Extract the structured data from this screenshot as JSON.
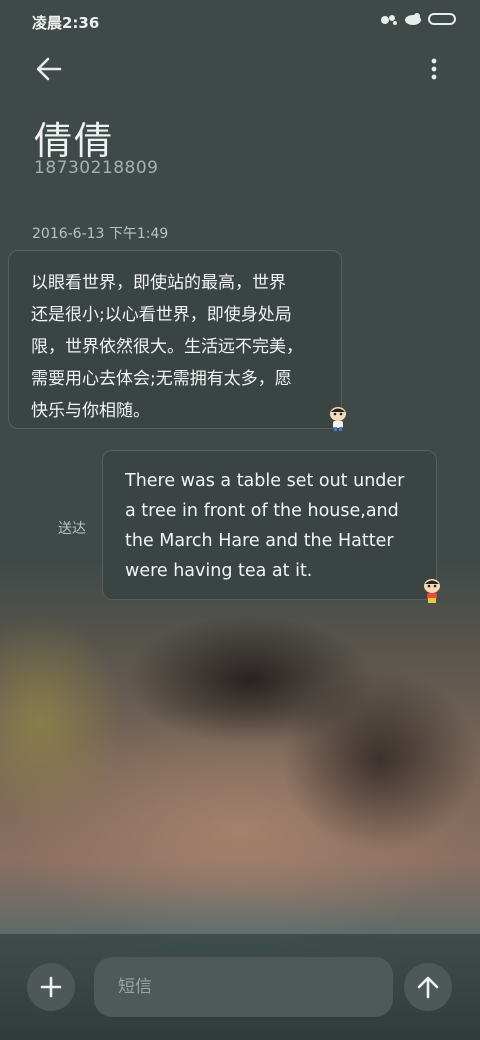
{
  "status_bar": {
    "time": "凌晨2:36"
  },
  "header": {
    "contact_name": "倩倩",
    "contact_number": "18730218809"
  },
  "conversation": {
    "timestamp": "2016-6-13 下午1:49",
    "messages": [
      {
        "direction": "incoming",
        "lines": [
          "以眼看世界，即使站的最高，世界",
          "还是很小;以心看世界，即使身处局",
          "限，世界依然很大。生活远不完美，",
          "需要用心去体会;无需拥有太多，愿",
          "快乐与你相随。"
        ]
      },
      {
        "direction": "outgoing",
        "status": "送达",
        "lines": [
          "There was a table set out under",
          "a tree in front of the house,and",
          "the March Hare and the Hatter",
          "were having tea at it."
        ]
      }
    ]
  },
  "composer": {
    "placeholder": "短信"
  },
  "icons": {
    "back": "arrow-left-icon",
    "menu": "more-vertical-icon",
    "add": "plus-icon",
    "send": "arrow-up-icon",
    "sticker": "cartoon-sticker-icon"
  },
  "colors": {
    "background": "#3f4a48",
    "bubble": "#3a4443",
    "button": "#4d5857"
  }
}
